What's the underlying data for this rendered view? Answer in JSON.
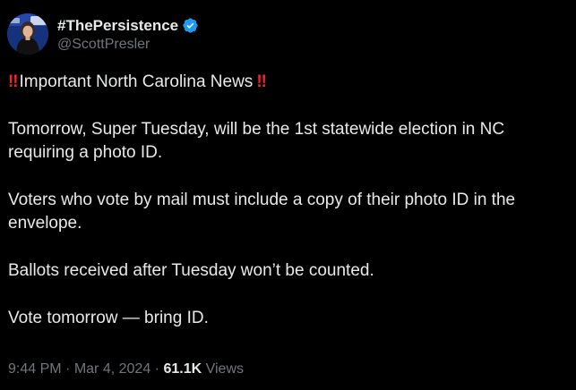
{
  "author": {
    "display_name": "#ThePersistence",
    "handle": "@ScottPresler",
    "verified_color": "#1d9bf0",
    "avatar_icon": "profile-photo"
  },
  "tweet": {
    "emphasis_emoji": "‼",
    "headline": "Important North Carolina News",
    "paragraphs": [
      "Tomorrow, Super Tuesday, will be the 1st statewide election in NC requiring a photo ID.",
      "Voters who vote by mail must include a copy of their photo ID in the envelope.",
      "Ballots received after Tuesday won’t be counted.",
      "Vote tomorrow — bring ID."
    ]
  },
  "meta": {
    "time": "9:44 PM",
    "separator": "·",
    "date": "Mar 4, 2024",
    "views_count": "61.1K",
    "views_label": "Views"
  },
  "colors": {
    "background": "#000000",
    "text": "#e7e9ea",
    "muted": "#71767b",
    "emoji_red": "#f4212e"
  }
}
